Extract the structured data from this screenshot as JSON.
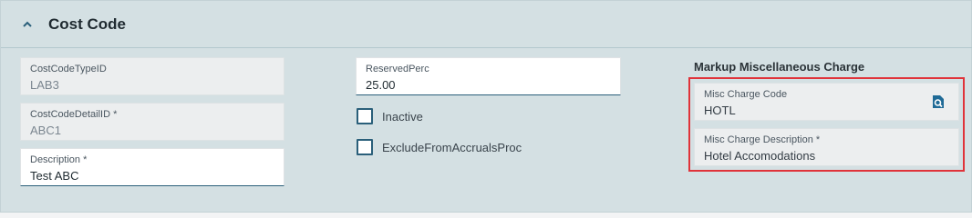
{
  "section": {
    "title": "Cost Code"
  },
  "fields": {
    "cost_code_type_id": {
      "label": "CostCodeTypeID",
      "value": "LAB3"
    },
    "cost_code_detail_id": {
      "label": "CostCodeDetailID *",
      "value": "ABC1"
    },
    "description": {
      "label": "Description *",
      "value": "Test ABC"
    },
    "reserved_perc": {
      "label": "ReservedPerc",
      "value": "25.00"
    }
  },
  "checkboxes": {
    "inactive": {
      "label": "Inactive",
      "checked": false
    },
    "exclude_from_accruals": {
      "label": "ExcludeFromAccrualsProc",
      "checked": false
    }
  },
  "markup": {
    "title": "Markup Miscellaneous Charge",
    "misc_charge_code": {
      "label": "Misc Charge Code",
      "value": "HOTL"
    },
    "misc_charge_description": {
      "label": "Misc Charge Description *",
      "value": "Hotel Accomodations"
    }
  },
  "colors": {
    "accent": "#2a5f7a",
    "highlight": "#e0333a",
    "panel_bg": "#d4e0e3"
  },
  "icons": {
    "collapse": "chevron-up-icon",
    "lookup": "search-lookup-icon"
  }
}
